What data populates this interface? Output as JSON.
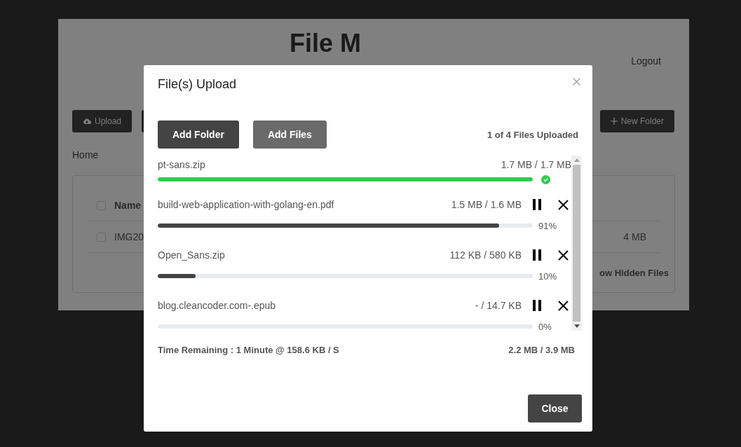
{
  "page": {
    "title": "File M",
    "logout": "Logout",
    "toolbar": {
      "upload": "Upload",
      "new_folder": "New Folder"
    },
    "breadcrumb": "Home",
    "table": {
      "header": "Name",
      "header_checked": false,
      "row": {
        "name": "IMG20",
        "size": "4 MB",
        "checked": false
      },
      "toggle": "ow Hidden Files"
    }
  },
  "dialog": {
    "title": "File(s) Upload",
    "buttons": [
      "Add Folder",
      "Add Files"
    ],
    "summary": "1 of 4 Files Uploaded",
    "files": [
      {
        "kind": "done",
        "name": "pt-sans.zip",
        "size": "1.7 MB / 1.7 MB",
        "level": 1
      },
      {
        "kind": "uploading",
        "name": "build-web-application-with-golang-en.pdf",
        "size": "1.5 MB / 1.6 MB",
        "level": 0.91,
        "percent": "91%"
      },
      {
        "kind": "uploading",
        "name": "Open_Sans.zip",
        "size": "112 KB / 580 KB",
        "level": 0.1,
        "percent": "10%"
      },
      {
        "kind": "uploading",
        "name": "blog.cleancoder.com-.epub",
        "size": "- / 14.7 KB",
        "level": 0,
        "percent": "0%"
      }
    ],
    "time_remaining": "Time Remaining : 1 Minute @ 158.6 KB / S",
    "total": "2.2 MB / 3.9 MB",
    "close": "Close"
  }
}
